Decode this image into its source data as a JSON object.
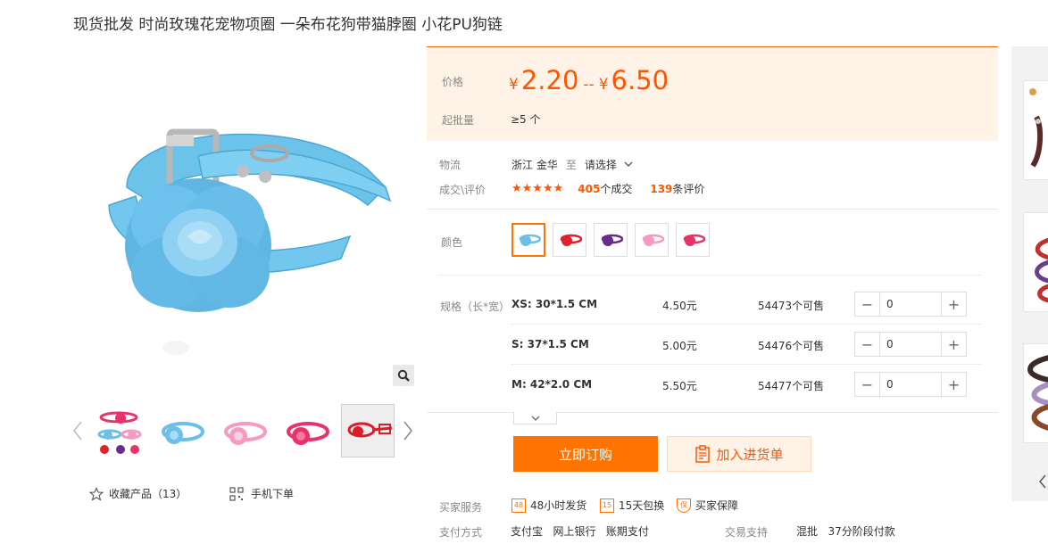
{
  "product": {
    "title": "现货批发 时尚玫瑰花宠物项圈 一朵布花狗带猫脖圈 小花PU狗链"
  },
  "gallery": {
    "thumbnails": [
      "thumb-1",
      "thumb-2",
      "thumb-3",
      "thumb-4",
      "thumb-5"
    ],
    "active_thumbnail": 5
  },
  "actions": {
    "favorite_label": "收藏产品（13）",
    "mobile_label": "手机下单"
  },
  "price": {
    "label": "价格",
    "currency": "¥",
    "min": "2.20",
    "separator": "--",
    "max": "6.50",
    "moq_label": "起批量",
    "moq_value": "≥5 个"
  },
  "logistics": {
    "label": "物流",
    "from": "浙江 金华",
    "to_word": "至",
    "select_text": "请选择"
  },
  "reviews": {
    "label": "成交\\评价",
    "stars": "★★★★★",
    "deals_count": "405",
    "deals_suffix": "个成交",
    "review_count": "139",
    "review_suffix": "条评价"
  },
  "colors": {
    "label": "颜色",
    "options": [
      {
        "name": "blue",
        "hex": "#6bbfe8"
      },
      {
        "name": "red",
        "hex": "#e0202a"
      },
      {
        "name": "purple",
        "hex": "#6a2b8a"
      },
      {
        "name": "pink",
        "hex": "#f59ac0"
      },
      {
        "name": "rose",
        "hex": "#e8336a"
      }
    ],
    "selected": 0
  },
  "specs": {
    "label": "规格（长*宽）",
    "rows": [
      {
        "name": "XS: 30*1.5 CM",
        "price": "4.50元",
        "stock": "54473个可售",
        "qty": "0"
      },
      {
        "name": "S: 37*1.5 CM",
        "price": "5.00元",
        "stock": "54476个可售",
        "qty": "0"
      },
      {
        "name": "M: 42*2.0 CM",
        "price": "5.50元",
        "stock": "54477个可售",
        "qty": "0"
      }
    ]
  },
  "buttons": {
    "buy": "立即订购",
    "cart": "加入进货单"
  },
  "services": {
    "label": "买家服务",
    "items": [
      {
        "icon": "48",
        "text": "48小时发货"
      },
      {
        "icon": "15",
        "text": "15天包换"
      },
      {
        "icon": "保",
        "text": "买家保障"
      }
    ]
  },
  "payment": {
    "label": "支付方式",
    "methods": "支付宝   网上银行   账期支付",
    "trade_label": "交易支持",
    "trade_value": "混批   37分阶段付款"
  },
  "theme": {
    "accent": "#ff7300",
    "price_color": "#ff5500",
    "price_bg": "#fff3e8"
  }
}
